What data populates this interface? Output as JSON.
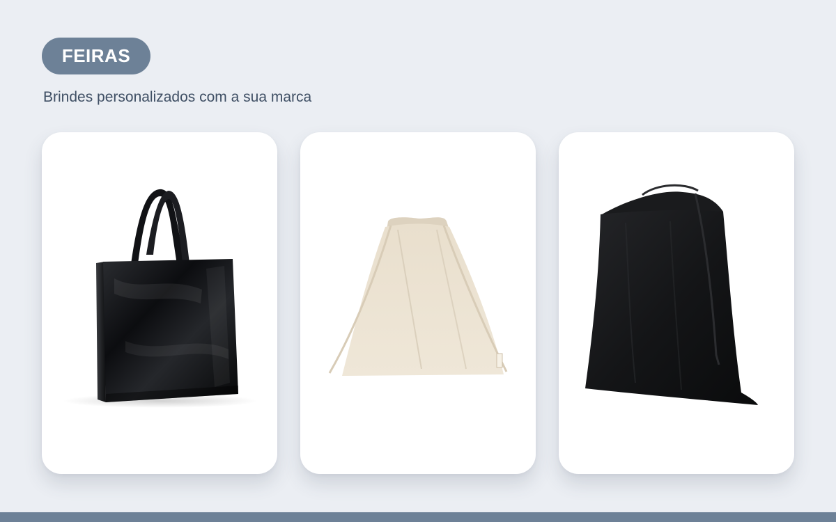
{
  "header": {
    "tag_label": "FEIRAS",
    "subtitle": "Brindes personalizados com a sua marca"
  },
  "products": [
    {
      "name": "black-laminated-tote-bag",
      "icon": "tote-bag-icon",
      "color": "#101114"
    },
    {
      "name": "natural-cotton-drawstring-bag",
      "icon": "drawstring-bag-icon",
      "color": "#ede5d6"
    },
    {
      "name": "black-nonwoven-drawstring-bag",
      "icon": "drawstring-bag-icon",
      "color": "#17181a"
    }
  ],
  "theme": {
    "background": "#ebeef3",
    "accent": "#6d8197",
    "subtitle_color": "#3f4f64",
    "card_background": "#ffffff"
  }
}
